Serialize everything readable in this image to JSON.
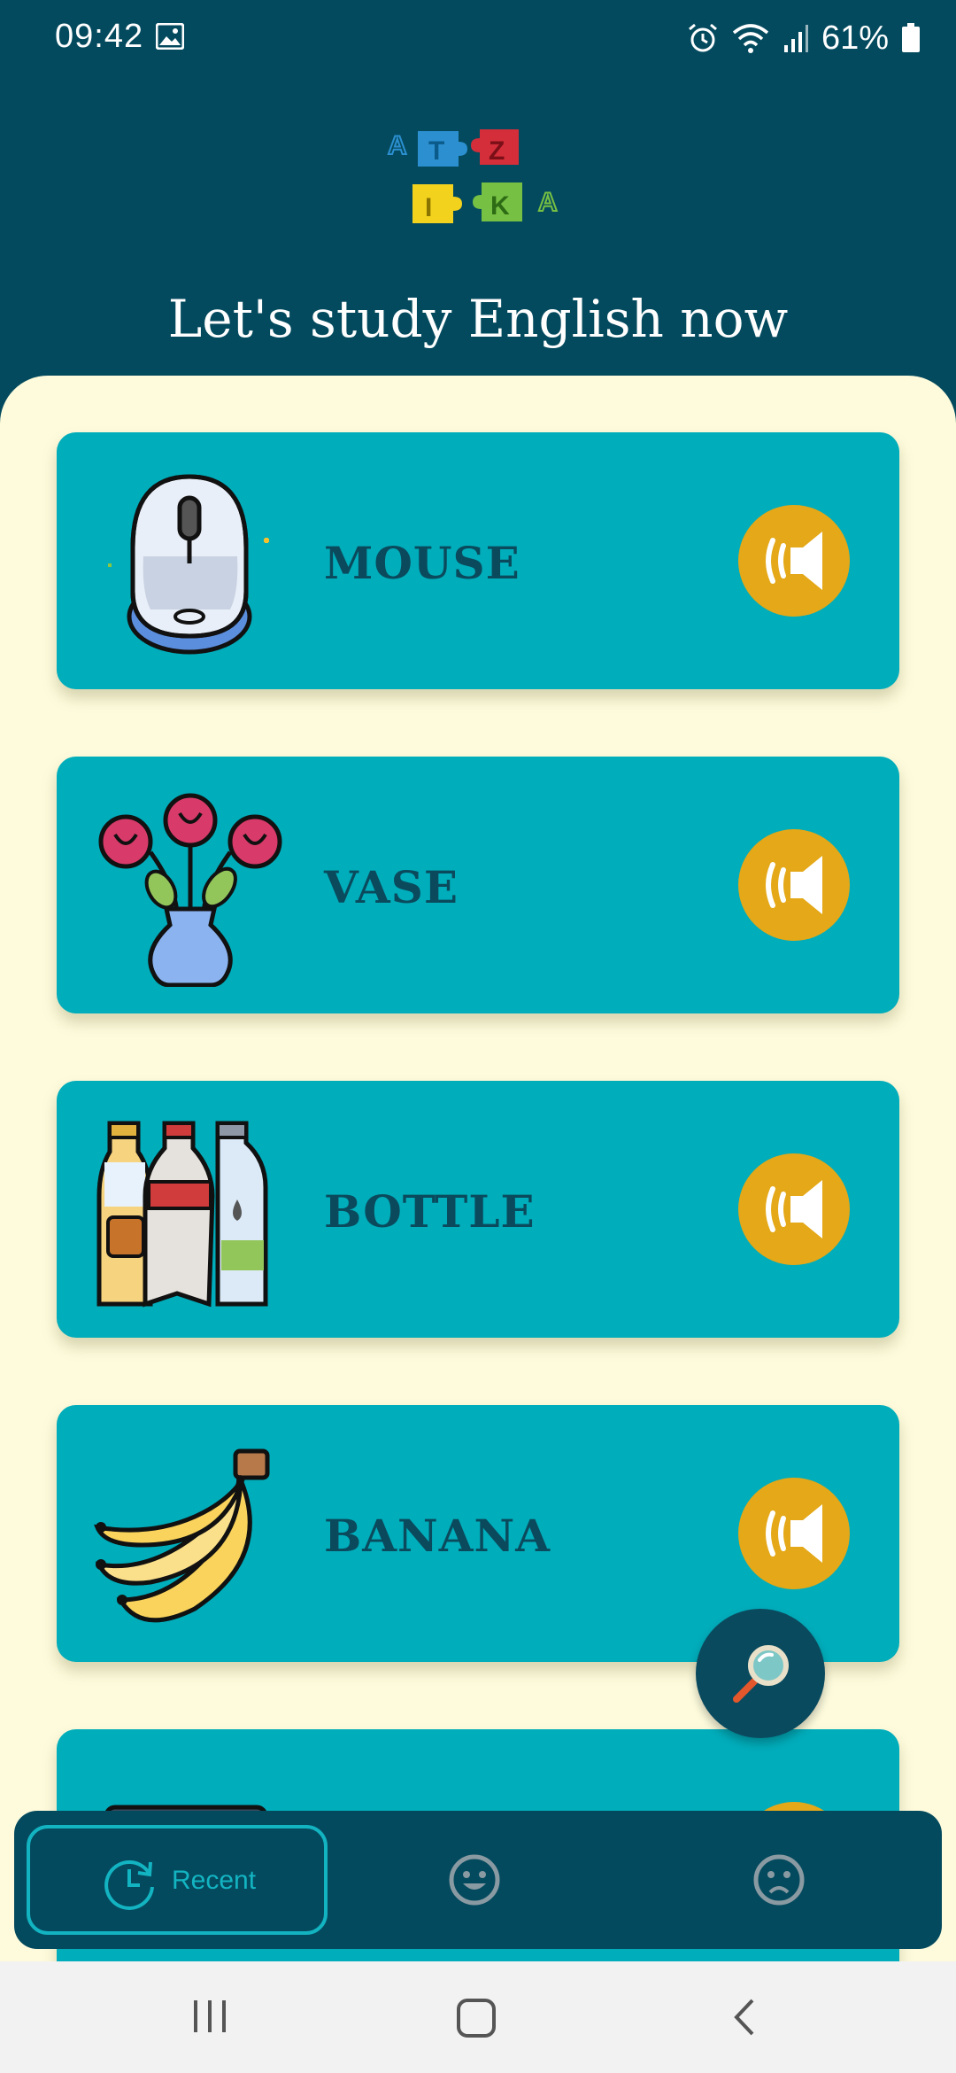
{
  "status_bar": {
    "time": "09:42",
    "battery": "61%",
    "icons": [
      "image-icon",
      "alarm-icon",
      "wifi-icon",
      "signal-icon",
      "battery-icon"
    ]
  },
  "header": {
    "logo_icon": "puzzle-logo-icon",
    "logo_letters": [
      "A",
      "T",
      "Z",
      "I",
      "K",
      "A"
    ],
    "headline": "Let's study English now"
  },
  "cards": [
    {
      "word": "MOUSE",
      "icon": "computer-mouse-icon"
    },
    {
      "word": "VASE",
      "icon": "flower-vase-icon"
    },
    {
      "word": "BOTTLE",
      "icon": "bottles-icon"
    },
    {
      "word": "BANANA",
      "icon": "banana-icon"
    }
  ],
  "fab": {
    "icon": "magnifier-icon"
  },
  "bottom_nav": {
    "recent_label": "Recent",
    "items": [
      {
        "label": "Recent",
        "icon": "history-icon",
        "active": true
      },
      {
        "icon": "happy-face-icon",
        "active": false
      },
      {
        "icon": "sad-face-icon",
        "active": false
      }
    ]
  },
  "colors": {
    "primary_dark": "#044a5e",
    "card": "#00adbb",
    "background": "#fdfbdc",
    "play_button": "#e4a818",
    "word_text": "#0a4a5c",
    "nav_accent": "#13b4c2"
  }
}
